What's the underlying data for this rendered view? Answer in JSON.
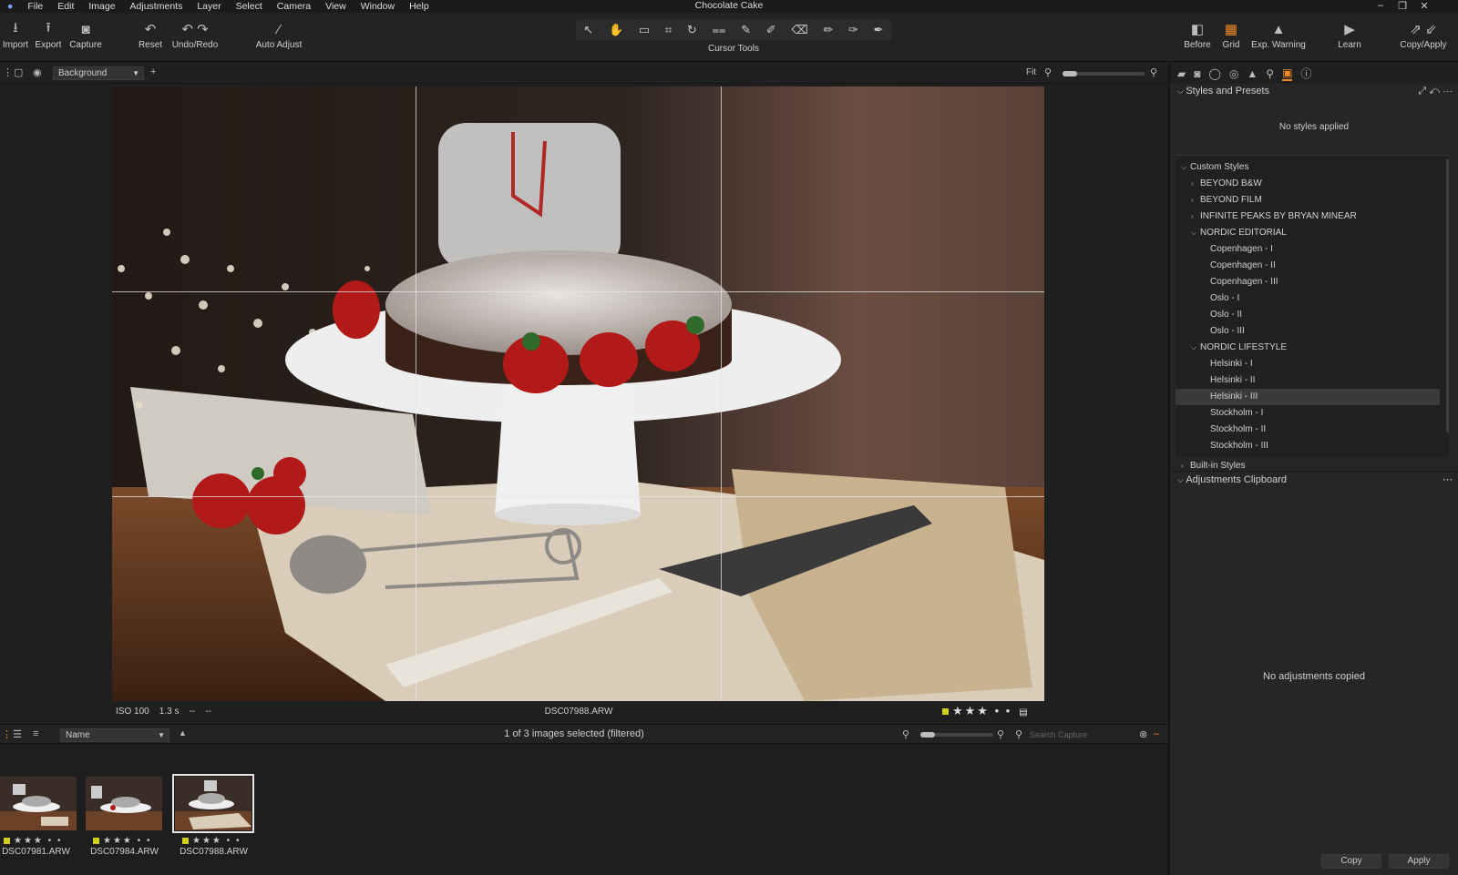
{
  "app": {
    "title": "Chocolate Cake"
  },
  "menu": [
    "File",
    "Edit",
    "Image",
    "Adjustments",
    "Layer",
    "Select",
    "Camera",
    "View",
    "Window",
    "Help"
  ],
  "toolbar": {
    "import": "Import",
    "export": "Export",
    "capture": "Capture",
    "reset": "Reset",
    "undo_redo": "Undo/Redo",
    "auto_adjust": "Auto Adjust",
    "cursor_tools": "Cursor Tools",
    "before": "Before",
    "grid": "Grid",
    "exp_warning": "Exp. Warning",
    "learn": "Learn",
    "copy_apply": "Copy/Apply"
  },
  "viewbar": {
    "layer": "Background",
    "zoom": "Fit"
  },
  "photo_info": {
    "exposure": "ISO 100    1.3 s    --    --",
    "filename": "DSC07988.ARW",
    "rating": "★★★ • •",
    "color_label": "#cfcf1c"
  },
  "browser": {
    "sort": "Name",
    "selection": "1 of 3 images selected (filtered)",
    "search_placeholder": "Search Capture",
    "thumbnails": [
      {
        "name": "DSC07981.ARW",
        "rating": "★★★ • •"
      },
      {
        "name": "DSC07984.ARW",
        "rating": "★★★ • •"
      },
      {
        "name": "DSC07988.ARW",
        "rating": "★★★ • •"
      }
    ]
  },
  "panel": {
    "styles_title": "Styles and Presets",
    "no_styles": "No styles applied",
    "tree": [
      {
        "label": "Custom Styles",
        "level": 0,
        "caret": "⌵"
      },
      {
        "label": "BEYOND B&W",
        "level": 1,
        "caret": "›"
      },
      {
        "label": "BEYOND FILM",
        "level": 1,
        "caret": "›"
      },
      {
        "label": "INFINITE PEAKS BY BRYAN MINEAR",
        "level": 1,
        "caret": "›"
      },
      {
        "label": "NORDIC EDITORIAL",
        "level": 1,
        "caret": "⌵"
      },
      {
        "label": "Copenhagen - I",
        "level": 2,
        "caret": ""
      },
      {
        "label": "Copenhagen - II",
        "level": 2,
        "caret": ""
      },
      {
        "label": "Copenhagen - III",
        "level": 2,
        "caret": ""
      },
      {
        "label": "Oslo - I",
        "level": 2,
        "caret": ""
      },
      {
        "label": "Oslo - II",
        "level": 2,
        "caret": ""
      },
      {
        "label": "Oslo - III",
        "level": 2,
        "caret": ""
      },
      {
        "label": "NORDIC LIFESTYLE",
        "level": 1,
        "caret": "⌵"
      },
      {
        "label": "Helsinki - I",
        "level": 2,
        "caret": ""
      },
      {
        "label": "Helsinki - II",
        "level": 2,
        "caret": ""
      },
      {
        "label": "Helsinki - III",
        "level": 2,
        "caret": "",
        "selected": true
      },
      {
        "label": "Stockholm - I",
        "level": 2,
        "caret": ""
      },
      {
        "label": "Stockholm - II",
        "level": 2,
        "caret": ""
      },
      {
        "label": "Stockholm - III",
        "level": 2,
        "caret": ""
      }
    ],
    "builtin": "Built-in Styles",
    "clipboard_title": "Adjustments Clipboard",
    "no_adjustments": "No adjustments copied",
    "copy": "Copy",
    "apply": "Apply"
  }
}
